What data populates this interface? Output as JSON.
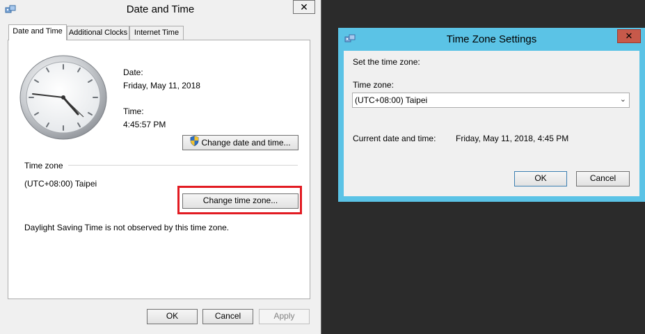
{
  "date_time_window": {
    "title": "Date and Time",
    "close_label": "✕",
    "tabs": [
      {
        "label": "Date and Time",
        "active": true
      },
      {
        "label": "Additional Clocks",
        "active": false
      },
      {
        "label": "Internet Time",
        "active": false
      }
    ],
    "date_label": "Date:",
    "date_value": "Friday, May 11, 2018",
    "time_label": "Time:",
    "time_value": "4:45:57 PM",
    "change_datetime_button": "Change date and time...",
    "timezone_section_label": "Time zone",
    "timezone_value": "(UTC+08:00) Taipei",
    "change_timezone_button": "Change time zone...",
    "dst_text": "Daylight Saving Time is not observed by this time zone.",
    "ok_button": "OK",
    "cancel_button": "Cancel",
    "apply_button": "Apply",
    "highlight_color": "#e21b22"
  },
  "timezone_window": {
    "title": "Time Zone Settings",
    "close_label": "✕",
    "title_bar_color": "#5bc3e6",
    "set_label": "Set the time zone:",
    "timezone_field_label": "Time zone:",
    "timezone_selected": "(UTC+08:00) Taipei",
    "current_label": "Current date and time:",
    "current_value": "Friday, May 11, 2018, 4:45 PM",
    "ok_button": "OK",
    "cancel_button": "Cancel"
  }
}
